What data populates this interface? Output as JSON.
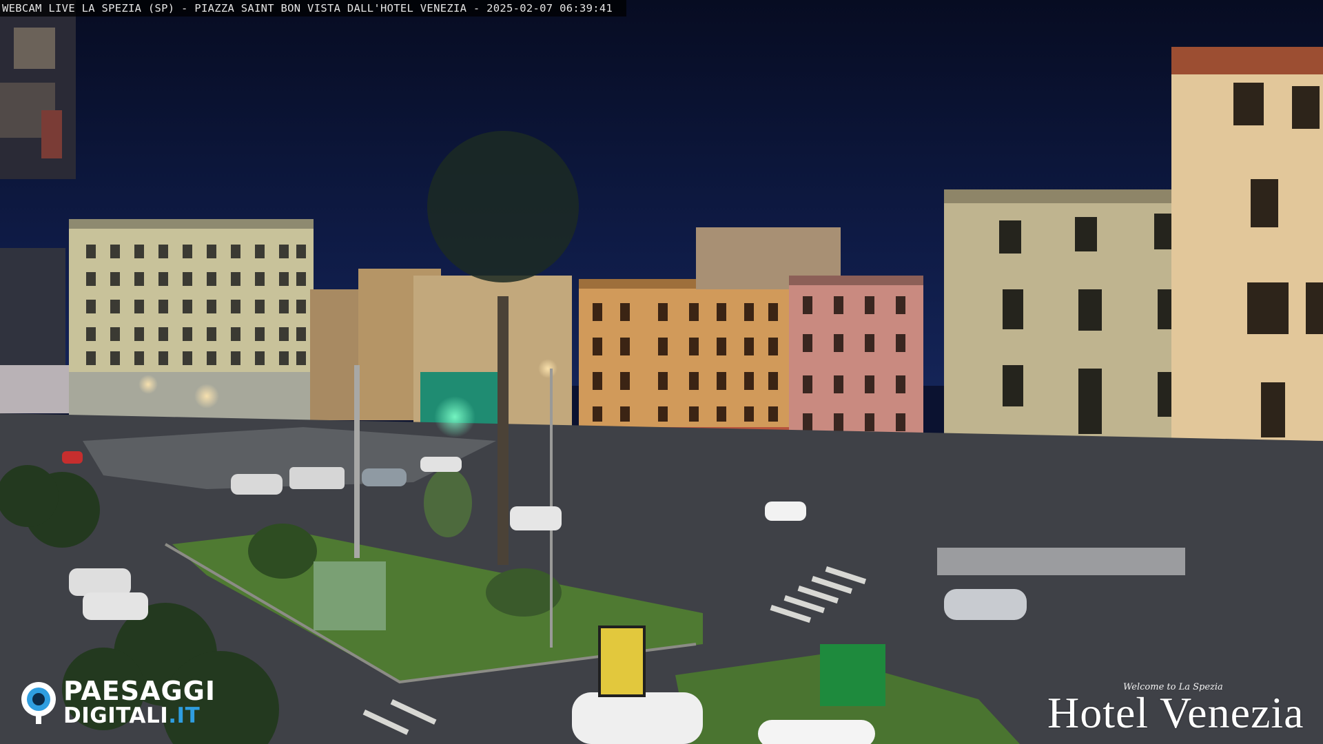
{
  "overlay": {
    "title": "WEBCAM LIVE LA SPEZIA (SP) - PIAZZA SAINT BON VISTA DALL'HOTEL VENEZIA - 2025-02-07 06:39:41"
  },
  "logo_left": {
    "line1": "PAESAGGI",
    "line2_main": "DIGITALI",
    "line2_accent": ".IT",
    "accent_color": "#2f9ee0"
  },
  "hotel_brand": {
    "tagline": "Welcome to La Spezia",
    "name": "Hotel Venezia"
  },
  "palette": {
    "sky": "#0b1230",
    "grass": "#4f7a32",
    "road": "#3f4147",
    "building_left": "#c8c29a",
    "building_center": "#d19a5a",
    "building_pink": "#c98a80",
    "building_right": "#bfb48f",
    "building_far_right": "#e2c79a"
  }
}
